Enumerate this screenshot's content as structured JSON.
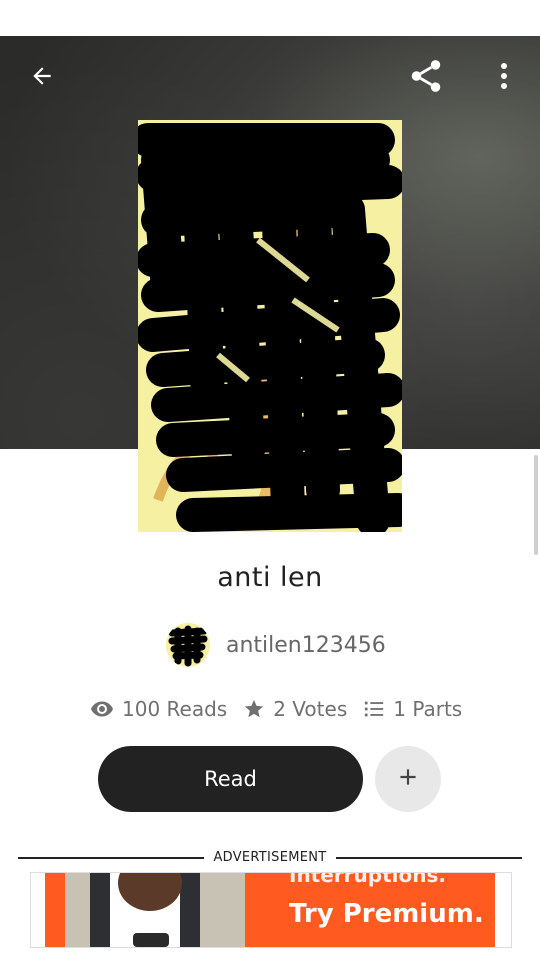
{
  "story": {
    "title": "anti len",
    "author": "antilen123456",
    "reads": "100 Reads",
    "votes": "2 Votes",
    "parts": "1 Parts"
  },
  "actions": {
    "read_label": "Read"
  },
  "ad": {
    "label": "ADVERTISEMENT",
    "headline": "Interruptions.",
    "cta": "Try Premium."
  },
  "colors": {
    "header_bg": "#2b2b2a",
    "button_dark": "#222222",
    "add_button_bg": "#e8e8e8",
    "cover_bg": "#f6f0a3",
    "ad_orange": "#ff5a1f"
  },
  "icons": [
    "arrow-back-icon",
    "share-icon",
    "more-vert-icon",
    "eye-icon",
    "star-icon",
    "list-icon",
    "plus-icon"
  ]
}
